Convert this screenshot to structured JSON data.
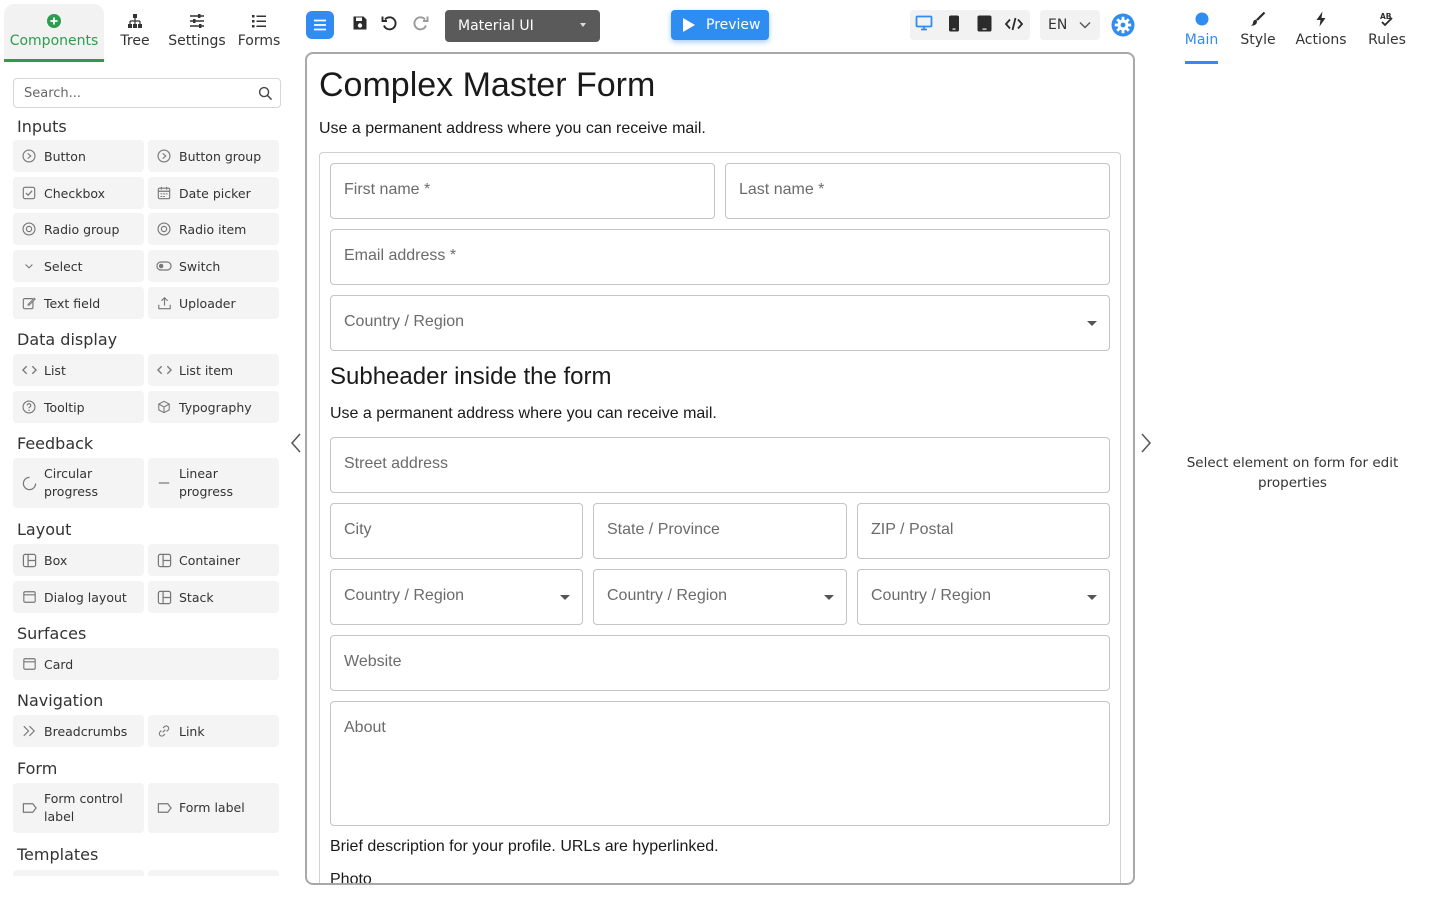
{
  "left_tabs": [
    {
      "label": "Components",
      "icon": "plus-circle-icon"
    },
    {
      "label": "Tree",
      "icon": "tree-icon"
    },
    {
      "label": "Settings",
      "icon": "sliders-icon"
    },
    {
      "label": "Forms",
      "icon": "list-icon"
    }
  ],
  "search": {
    "placeholder": "Search..."
  },
  "sections": {
    "inputs": "Inputs",
    "data_display": "Data display",
    "feedback": "Feedback",
    "layout": "Layout",
    "surfaces": "Surfaces",
    "navigation": "Navigation",
    "form": "Form",
    "templates": "Templates"
  },
  "components": {
    "button": "Button",
    "button_group": "Button group",
    "checkbox": "Checkbox",
    "date_picker": "Date picker",
    "radio_group": "Radio group",
    "radio_item": "Radio item",
    "select": "Select",
    "switch": "Switch",
    "text_field": "Text field",
    "uploader": "Uploader",
    "list": "List",
    "list_item": "List item",
    "tooltip": "Tooltip",
    "typography": "Typography",
    "circular_progress": "Circular progress",
    "linear_progress": "Linear progress",
    "box": "Box",
    "container": "Container",
    "dialog_layout": "Dialog layout",
    "stack": "Stack",
    "card": "Card",
    "breadcrumbs": "Breadcrumbs",
    "link": "Link",
    "form_control_label": "Form control label",
    "form_label": "Form label"
  },
  "toolbar": {
    "theme_value": "Material UI",
    "preview_label": "Preview",
    "language": "EN",
    "accent": "#2f8cf0"
  },
  "form": {
    "title": "Complex Master Form",
    "description": "Use a permanent address where you can receive mail.",
    "first_name": "First name *",
    "last_name": "Last name *",
    "email": "Email address *",
    "country_region": "Country / Region",
    "subheader": "Subheader inside the form",
    "sub_description": "Use a permanent address where you can receive mail.",
    "street_address": "Street address",
    "city": "City",
    "state": "State / Province",
    "zip": "ZIP / Postal",
    "website": "Website",
    "about": "About",
    "help_text": "Brief description for your profile. URLs are hyperlinked.",
    "photo": "Photo"
  },
  "right_tabs": [
    {
      "label": "Main",
      "icon": "dot-icon"
    },
    {
      "label": "Style",
      "icon": "brush-icon"
    },
    {
      "label": "Actions",
      "icon": "lightning-icon"
    },
    {
      "label": "Rules",
      "icon": "rules-icon"
    }
  ],
  "right_panel": {
    "hint": "Select element on form for edit properties"
  }
}
